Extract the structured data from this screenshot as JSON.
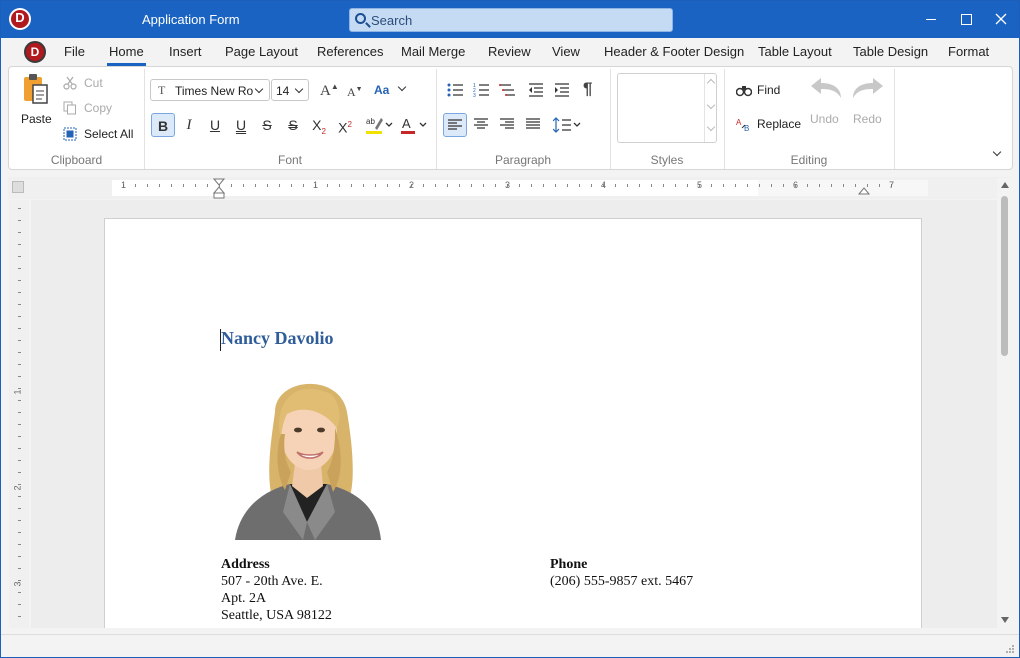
{
  "window": {
    "title": "Application Form",
    "search_placeholder": "Search"
  },
  "menu": {
    "tabs": [
      "File",
      "Home",
      "Insert",
      "Page Layout",
      "References",
      "Mail Merge",
      "Review",
      "View",
      "Header & Footer Design",
      "Table Layout",
      "Table Design",
      "Format"
    ],
    "active_tab": "Home"
  },
  "ribbon": {
    "clipboard": {
      "label": "Clipboard",
      "paste": "Paste",
      "cut": "Cut",
      "copy": "Copy",
      "select_all": "Select All"
    },
    "font": {
      "label": "Font",
      "font_name": "Times New Roman",
      "font_size": "14",
      "case_label": "Aa"
    },
    "paragraph": {
      "label": "Paragraph"
    },
    "styles": {
      "label": "Styles"
    },
    "editing": {
      "label": "Editing",
      "find": "Find",
      "replace": "Replace",
      "undo": "Undo",
      "redo": "Redo"
    }
  },
  "ruler": {
    "numbers": [
      "1",
      "1",
      "2",
      "3",
      "4",
      "5",
      "6",
      "7"
    ],
    "vertical_numbers": [
      "1",
      "2",
      "3"
    ]
  },
  "document": {
    "name": "Nancy Davolio",
    "address_label": "Address",
    "address_lines": [
      "507 - 20th Ave. E.",
      "Apt. 2A",
      "Seattle, USA 98122"
    ],
    "phone_label": "Phone",
    "phone": "(206) 555-9857 ext. 5467"
  },
  "colors": {
    "title_bar": "#1a63c2",
    "accent": "#1a63c2",
    "name_heading": "#2f5d9a"
  }
}
